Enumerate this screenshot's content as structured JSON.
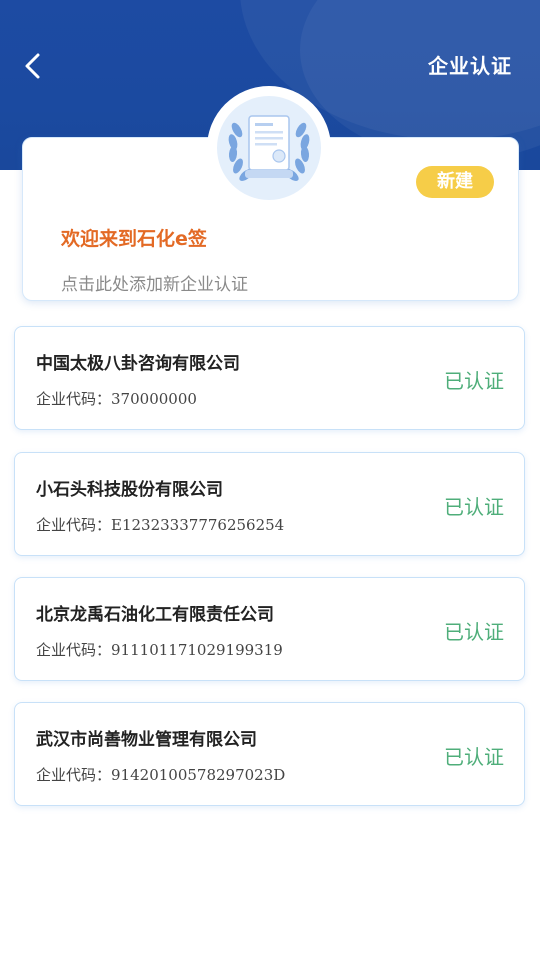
{
  "header": {
    "title": "企业认证"
  },
  "new_card": {
    "badge_label": "新建",
    "welcome": "欢迎来到石化e签",
    "hint": "点击此处添加新企业认证"
  },
  "code_prefix": "企业代码：",
  "companies": [
    {
      "name": "中国太极八卦咨询有限公司",
      "code": "370000000",
      "status": "已认证"
    },
    {
      "name": "小石头科技股份有限公司",
      "code": "E12323337776256254",
      "status": "已认证"
    },
    {
      "name": "北京龙禹石油化工有限责任公司",
      "code": "911101171029199319",
      "status": "已认证"
    },
    {
      "name": "武汉市尚善物业管理有限公司",
      "code": "91420100578297023D",
      "status": "已认证"
    }
  ],
  "colors": {
    "header_blue": "#1d4ba3",
    "badge_yellow": "#f6cd48",
    "welcome_orange": "#e36a25",
    "verified_green": "#4fae7a"
  },
  "icons": {
    "back": "chevron-left-icon",
    "emblem": "certificate-icon"
  }
}
